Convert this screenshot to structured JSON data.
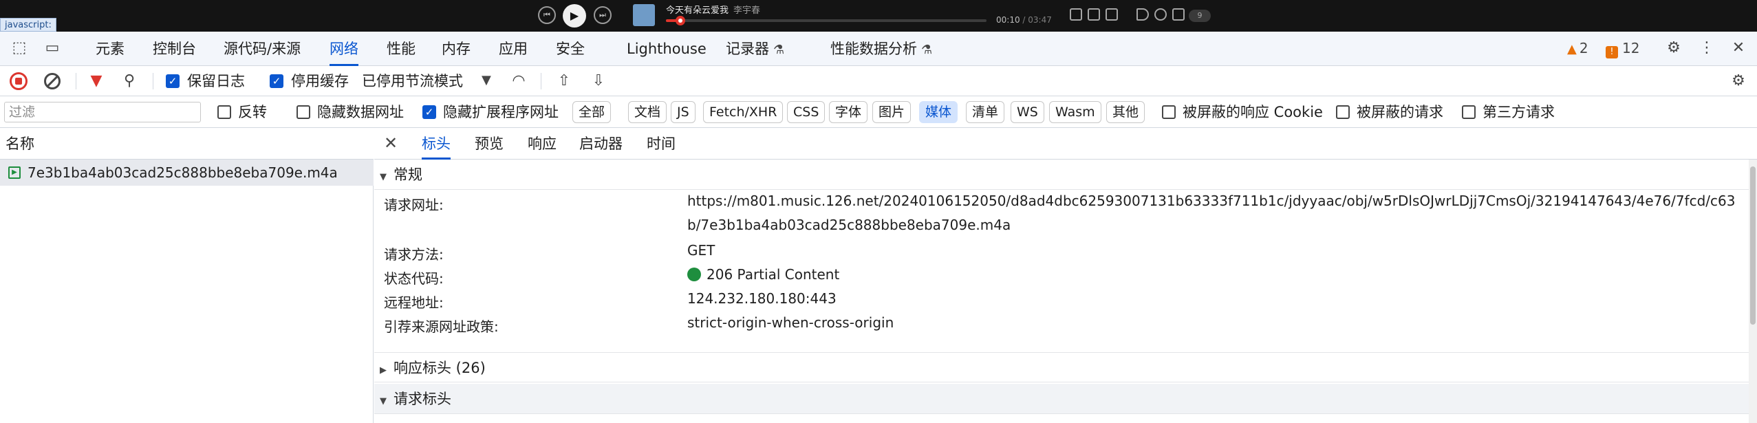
{
  "player": {
    "badge": "javascript:",
    "song_title": "今天有朵云爱我",
    "artist": "李宇春",
    "time_current": "00:10",
    "time_total": "/ 03:47",
    "progress_fraction": 0.044,
    "volume_label": "9",
    "colors": {
      "bg": "#141414",
      "accent": "#e1342b"
    }
  },
  "tabs": {
    "items": [
      {
        "label": "元素"
      },
      {
        "label": "控制台"
      },
      {
        "label": "源代码/来源"
      },
      {
        "label": "网络"
      },
      {
        "label": "性能"
      },
      {
        "label": "内存"
      },
      {
        "label": "应用"
      },
      {
        "label": "安全"
      },
      {
        "label": "Lighthouse"
      },
      {
        "label": "记录器"
      },
      {
        "label": "性能数据分析"
      }
    ],
    "active_label": "网络",
    "warnings_count": "2",
    "errors_count": "12"
  },
  "toolbar": {
    "preserve_log_label": "保留日志",
    "preserve_log_checked": true,
    "disable_cache_label": "停用缓存",
    "disable_cache_checked": true,
    "throttling_label": "已停用节流模式"
  },
  "filter": {
    "placeholder": "过滤",
    "value": "",
    "invert_label": "反转",
    "hide_data_urls_label": "隐藏数据网址",
    "hide_ext_urls_label": "隐藏扩展程序网址",
    "hide_ext_urls_checked": true,
    "type_chips": [
      "全部",
      "文档",
      "JS",
      "Fetch/XHR",
      "CSS",
      "字体",
      "图片",
      "媒体",
      "清单",
      "WS",
      "Wasm",
      "其他"
    ],
    "selected_chip": "媒体",
    "blocked_cookies_label": "被屏蔽的响应 Cookie",
    "blocked_requests_label": "被屏蔽的请求",
    "third_party_label": "第三方请求"
  },
  "request_list": {
    "column_header": "名称",
    "rows": [
      {
        "name": "7e3b1ba4ab03cad25c888bbe8eba709e.m4a",
        "type_icon": "media-icon"
      }
    ]
  },
  "details": {
    "tabs": [
      "标头",
      "预览",
      "响应",
      "启动器",
      "时间"
    ],
    "active_tab": "标头",
    "general_title": "常规",
    "general_rows": [
      {
        "key": "请求网址:",
        "value": "https://m801.music.126.net/20240106152050/d8ad4dbc62593007131b63333f711b1c/jdyyaac/obj/w5rDlsOJwrLDjj7CmsOj/32194147643/4e76/7fcd/c63b/7e3b1ba4ab03cad25c888bbe8eba709e.m4a"
      },
      {
        "key": "请求方法:",
        "value": "GET"
      },
      {
        "key": "状态代码:",
        "value": "206 Partial Content"
      },
      {
        "key": "远程地址:",
        "value": "124.232.180.180:443"
      },
      {
        "key": "引荐来源网址政策:",
        "value": "strict-origin-when-cross-origin"
      }
    ],
    "response_headers_title": "响应标头 (26)",
    "request_headers_title": "请求标头"
  },
  "colors": {
    "accent_blue": "#0b57d0",
    "record_red": "#dc362e",
    "status_green": "#1e8e3e",
    "warning_orange": "#e8710a"
  }
}
